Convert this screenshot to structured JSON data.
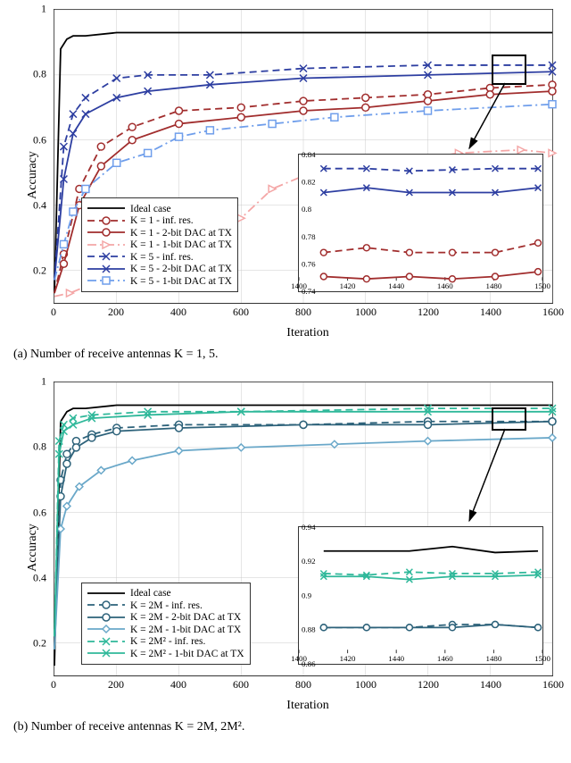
{
  "chart_data": [
    {
      "id": "a",
      "type": "line",
      "title": "",
      "xlabel": "Iteration",
      "ylabel": "Accuracy",
      "xlim": [
        0,
        1600
      ],
      "ylim": [
        0.1,
        1.0
      ],
      "xticks": [
        0,
        200,
        400,
        600,
        800,
        1000,
        1200,
        1400,
        1600
      ],
      "yticks": [
        0.2,
        0.4,
        0.6,
        0.8,
        1.0
      ],
      "caption": "(a) Number of receive antennas K = 1, 5.",
      "legend": {
        "position": "lower-left",
        "items": [
          {
            "name": "Ideal case",
            "color": "#000000",
            "dash": "solid",
            "marker": "none"
          },
          {
            "name": "K = 1 - inf. res.",
            "color": "#a12d2d",
            "dash": "dashed",
            "marker": "circle"
          },
          {
            "name": "K = 1 - 2-bit DAC at TX",
            "color": "#a12d2d",
            "dash": "solid",
            "marker": "circle"
          },
          {
            "name": "K = 1 - 1-bit DAC at TX",
            "color": "#f4a6a6",
            "dash": "dashdot",
            "marker": "triangle"
          },
          {
            "name": "K = 5 - inf. res.",
            "color": "#2d3ea1",
            "dash": "dashed",
            "marker": "x"
          },
          {
            "name": "K = 5 - 2-bit DAC at TX",
            "color": "#2d3ea1",
            "dash": "solid",
            "marker": "x"
          },
          {
            "name": "K = 5 - 1-bit DAC at TX",
            "color": "#6f9eeb",
            "dash": "dashdot",
            "marker": "square"
          }
        ]
      },
      "series": [
        {
          "name": "Ideal case",
          "color": "#000000",
          "dash": "solid",
          "marker": "none",
          "x": [
            0,
            20,
            40,
            60,
            100,
            200,
            400,
            800,
            1200,
            1600
          ],
          "y": [
            0.13,
            0.88,
            0.91,
            0.92,
            0.92,
            0.93,
            0.93,
            0.93,
            0.93,
            0.93
          ]
        },
        {
          "name": "K=1 inf res",
          "color": "#a12d2d",
          "dash": "dashed",
          "marker": "circle",
          "x": [
            0,
            30,
            80,
            150,
            250,
            400,
            600,
            800,
            1000,
            1200,
            1400,
            1600
          ],
          "y": [
            0.13,
            0.25,
            0.45,
            0.58,
            0.64,
            0.69,
            0.7,
            0.72,
            0.73,
            0.74,
            0.76,
            0.77
          ]
        },
        {
          "name": "K=1 2bit",
          "color": "#a12d2d",
          "dash": "solid",
          "marker": "circle",
          "x": [
            0,
            30,
            80,
            150,
            250,
            400,
            600,
            800,
            1000,
            1200,
            1400,
            1600
          ],
          "y": [
            0.13,
            0.22,
            0.4,
            0.52,
            0.6,
            0.65,
            0.67,
            0.69,
            0.7,
            0.72,
            0.74,
            0.75
          ]
        },
        {
          "name": "K=1 1bit",
          "color": "#f4a6a6",
          "dash": "dashdot",
          "marker": "triangle",
          "x": [
            0,
            50,
            100,
            200,
            300,
            400,
            500,
            600,
            700,
            800,
            900,
            1000,
            1100,
            1300,
            1500,
            1600
          ],
          "y": [
            0.12,
            0.13,
            0.15,
            0.19,
            0.22,
            0.28,
            0.33,
            0.36,
            0.45,
            0.49,
            0.49,
            0.5,
            0.53,
            0.56,
            0.57,
            0.56
          ]
        },
        {
          "name": "K=5 inf res",
          "color": "#2d3ea1",
          "dash": "dashed",
          "marker": "x",
          "x": [
            0,
            30,
            60,
            100,
            200,
            300,
            500,
            800,
            1200,
            1600
          ],
          "y": [
            0.17,
            0.58,
            0.68,
            0.73,
            0.79,
            0.8,
            0.8,
            0.82,
            0.83,
            0.83
          ]
        },
        {
          "name": "K=5 2bit",
          "color": "#2d3ea1",
          "dash": "solid",
          "marker": "x",
          "x": [
            0,
            30,
            60,
            100,
            200,
            300,
            500,
            800,
            1200,
            1600
          ],
          "y": [
            0.17,
            0.48,
            0.62,
            0.68,
            0.73,
            0.75,
            0.77,
            0.79,
            0.8,
            0.81
          ]
        },
        {
          "name": "K=5 1bit",
          "color": "#6f9eeb",
          "dash": "dashdot",
          "marker": "square",
          "x": [
            0,
            30,
            60,
            100,
            200,
            300,
            400,
            500,
            700,
            900,
            1200,
            1600
          ],
          "y": [
            0.17,
            0.28,
            0.38,
            0.45,
            0.53,
            0.56,
            0.61,
            0.63,
            0.65,
            0.67,
            0.69,
            0.71
          ]
        }
      ],
      "inset": {
        "xlim": [
          1400,
          1500
        ],
        "ylim": [
          0.74,
          0.84
        ],
        "xticks": [
          1400,
          1420,
          1440,
          1460,
          1480,
          1500
        ],
        "yticks": [
          0.74,
          0.76,
          0.78,
          0.8,
          0.82,
          0.84
        ],
        "series": [
          {
            "color": "#2d3ea1",
            "dash": "dashed",
            "marker": "x",
            "y": [
              0.832,
              0.832,
              0.83,
              0.831,
              0.832,
              0.832
            ]
          },
          {
            "color": "#2d3ea1",
            "dash": "solid",
            "marker": "x",
            "y": [
              0.812,
              0.816,
              0.812,
              0.812,
              0.812,
              0.816
            ]
          },
          {
            "color": "#a12d2d",
            "dash": "dashed",
            "marker": "circle",
            "y": [
              0.762,
              0.766,
              0.762,
              0.762,
              0.762,
              0.77
            ]
          },
          {
            "color": "#a12d2d",
            "dash": "solid",
            "marker": "circle",
            "y": [
              0.742,
              0.74,
              0.742,
              0.74,
              0.742,
              0.746
            ]
          }
        ]
      }
    },
    {
      "id": "b",
      "type": "line",
      "title": "",
      "xlabel": "Iteration",
      "ylabel": "Accuracy",
      "xlim": [
        0,
        1600
      ],
      "ylim": [
        0.1,
        1.0
      ],
      "xticks": [
        0,
        200,
        400,
        600,
        800,
        1000,
        1200,
        1400,
        1600
      ],
      "yticks": [
        0.2,
        0.4,
        0.6,
        0.8,
        1.0
      ],
      "caption": "(b) Number of receive antennas K = 2M, 2M².",
      "legend": {
        "position": "lower-left",
        "items": [
          {
            "name": "Ideal case",
            "color": "#000000",
            "dash": "solid",
            "marker": "none"
          },
          {
            "name": "K = 2M - inf. res.",
            "color": "#2d627a",
            "dash": "dashed",
            "marker": "circle"
          },
          {
            "name": "K = 2M - 2-bit DAC at TX",
            "color": "#2d627a",
            "dash": "solid",
            "marker": "circle"
          },
          {
            "name": "K = 2M - 1-bit DAC at TX",
            "color": "#6aa8c9",
            "dash": "solid",
            "marker": "diamond"
          },
          {
            "name": "K = 2M² - inf. res.",
            "color": "#2fb89a",
            "dash": "dashed",
            "marker": "x"
          },
          {
            "name": "K = 2M² - 1-bit DAC at TX",
            "color": "#2fb89a",
            "dash": "solid",
            "marker": "x"
          }
        ]
      },
      "series": [
        {
          "name": "Ideal case",
          "color": "#000000",
          "dash": "solid",
          "marker": "none",
          "x": [
            0,
            20,
            40,
            60,
            100,
            200,
            400,
            800,
            1200,
            1600
          ],
          "y": [
            0.13,
            0.88,
            0.91,
            0.92,
            0.92,
            0.93,
            0.93,
            0.93,
            0.93,
            0.93
          ]
        },
        {
          "name": "K=2M inf",
          "color": "#2d627a",
          "dash": "dashed",
          "marker": "circle",
          "x": [
            0,
            20,
            40,
            70,
            120,
            200,
            400,
            800,
            1200,
            1600
          ],
          "y": [
            0.18,
            0.7,
            0.78,
            0.82,
            0.84,
            0.86,
            0.87,
            0.87,
            0.88,
            0.88
          ]
        },
        {
          "name": "K=2M 2bit",
          "color": "#2d627a",
          "dash": "solid",
          "marker": "circle",
          "x": [
            0,
            20,
            40,
            70,
            120,
            200,
            400,
            800,
            1200,
            1600
          ],
          "y": [
            0.18,
            0.65,
            0.75,
            0.8,
            0.83,
            0.85,
            0.86,
            0.87,
            0.87,
            0.88
          ]
        },
        {
          "name": "K=2M 1bit",
          "color": "#6aa8c9",
          "dash": "solid",
          "marker": "diamond",
          "x": [
            0,
            20,
            40,
            80,
            150,
            250,
            400,
            600,
            900,
            1200,
            1600
          ],
          "y": [
            0.18,
            0.55,
            0.62,
            0.68,
            0.73,
            0.76,
            0.79,
            0.8,
            0.81,
            0.82,
            0.83
          ]
        },
        {
          "name": "K=2M2 inf",
          "color": "#2fb89a",
          "dash": "dashed",
          "marker": "x",
          "x": [
            0,
            15,
            30,
            60,
            120,
            300,
            600,
            1200,
            1600
          ],
          "y": [
            0.22,
            0.82,
            0.87,
            0.89,
            0.9,
            0.91,
            0.91,
            0.92,
            0.92
          ]
        },
        {
          "name": "K=2M2 1bit",
          "color": "#2fb89a",
          "dash": "solid",
          "marker": "x",
          "x": [
            0,
            15,
            30,
            60,
            120,
            300,
            600,
            1200,
            1600
          ],
          "y": [
            0.22,
            0.78,
            0.85,
            0.87,
            0.89,
            0.9,
            0.91,
            0.91,
            0.91
          ]
        }
      ],
      "inset": {
        "xlim": [
          1400,
          1500
        ],
        "ylim": [
          0.86,
          0.94
        ],
        "xticks": [
          1400,
          1420,
          1440,
          1460,
          1480,
          1500
        ],
        "yticks": [
          0.86,
          0.88,
          0.9,
          0.92,
          0.94
        ],
        "series": [
          {
            "color": "#000000",
            "dash": "solid",
            "marker": "none",
            "y": [
              0.927,
              0.927,
              0.927,
              0.93,
              0.926,
              0.927
            ]
          },
          {
            "color": "#2fb89a",
            "dash": "dashed",
            "marker": "x",
            "y": [
              0.912,
              0.911,
              0.913,
              0.912,
              0.912,
              0.913
            ]
          },
          {
            "color": "#2fb89a",
            "dash": "solid",
            "marker": "x",
            "y": [
              0.91,
              0.91,
              0.908,
              0.91,
              0.91,
              0.911
            ]
          },
          {
            "color": "#2d627a",
            "dash": "dashed",
            "marker": "circle",
            "y": [
              0.876,
              0.876,
              0.876,
              0.878,
              0.878,
              0.876
            ]
          },
          {
            "color": "#2d627a",
            "dash": "solid",
            "marker": "circle",
            "y": [
              0.876,
              0.876,
              0.876,
              0.876,
              0.878,
              0.876
            ]
          }
        ]
      }
    }
  ]
}
